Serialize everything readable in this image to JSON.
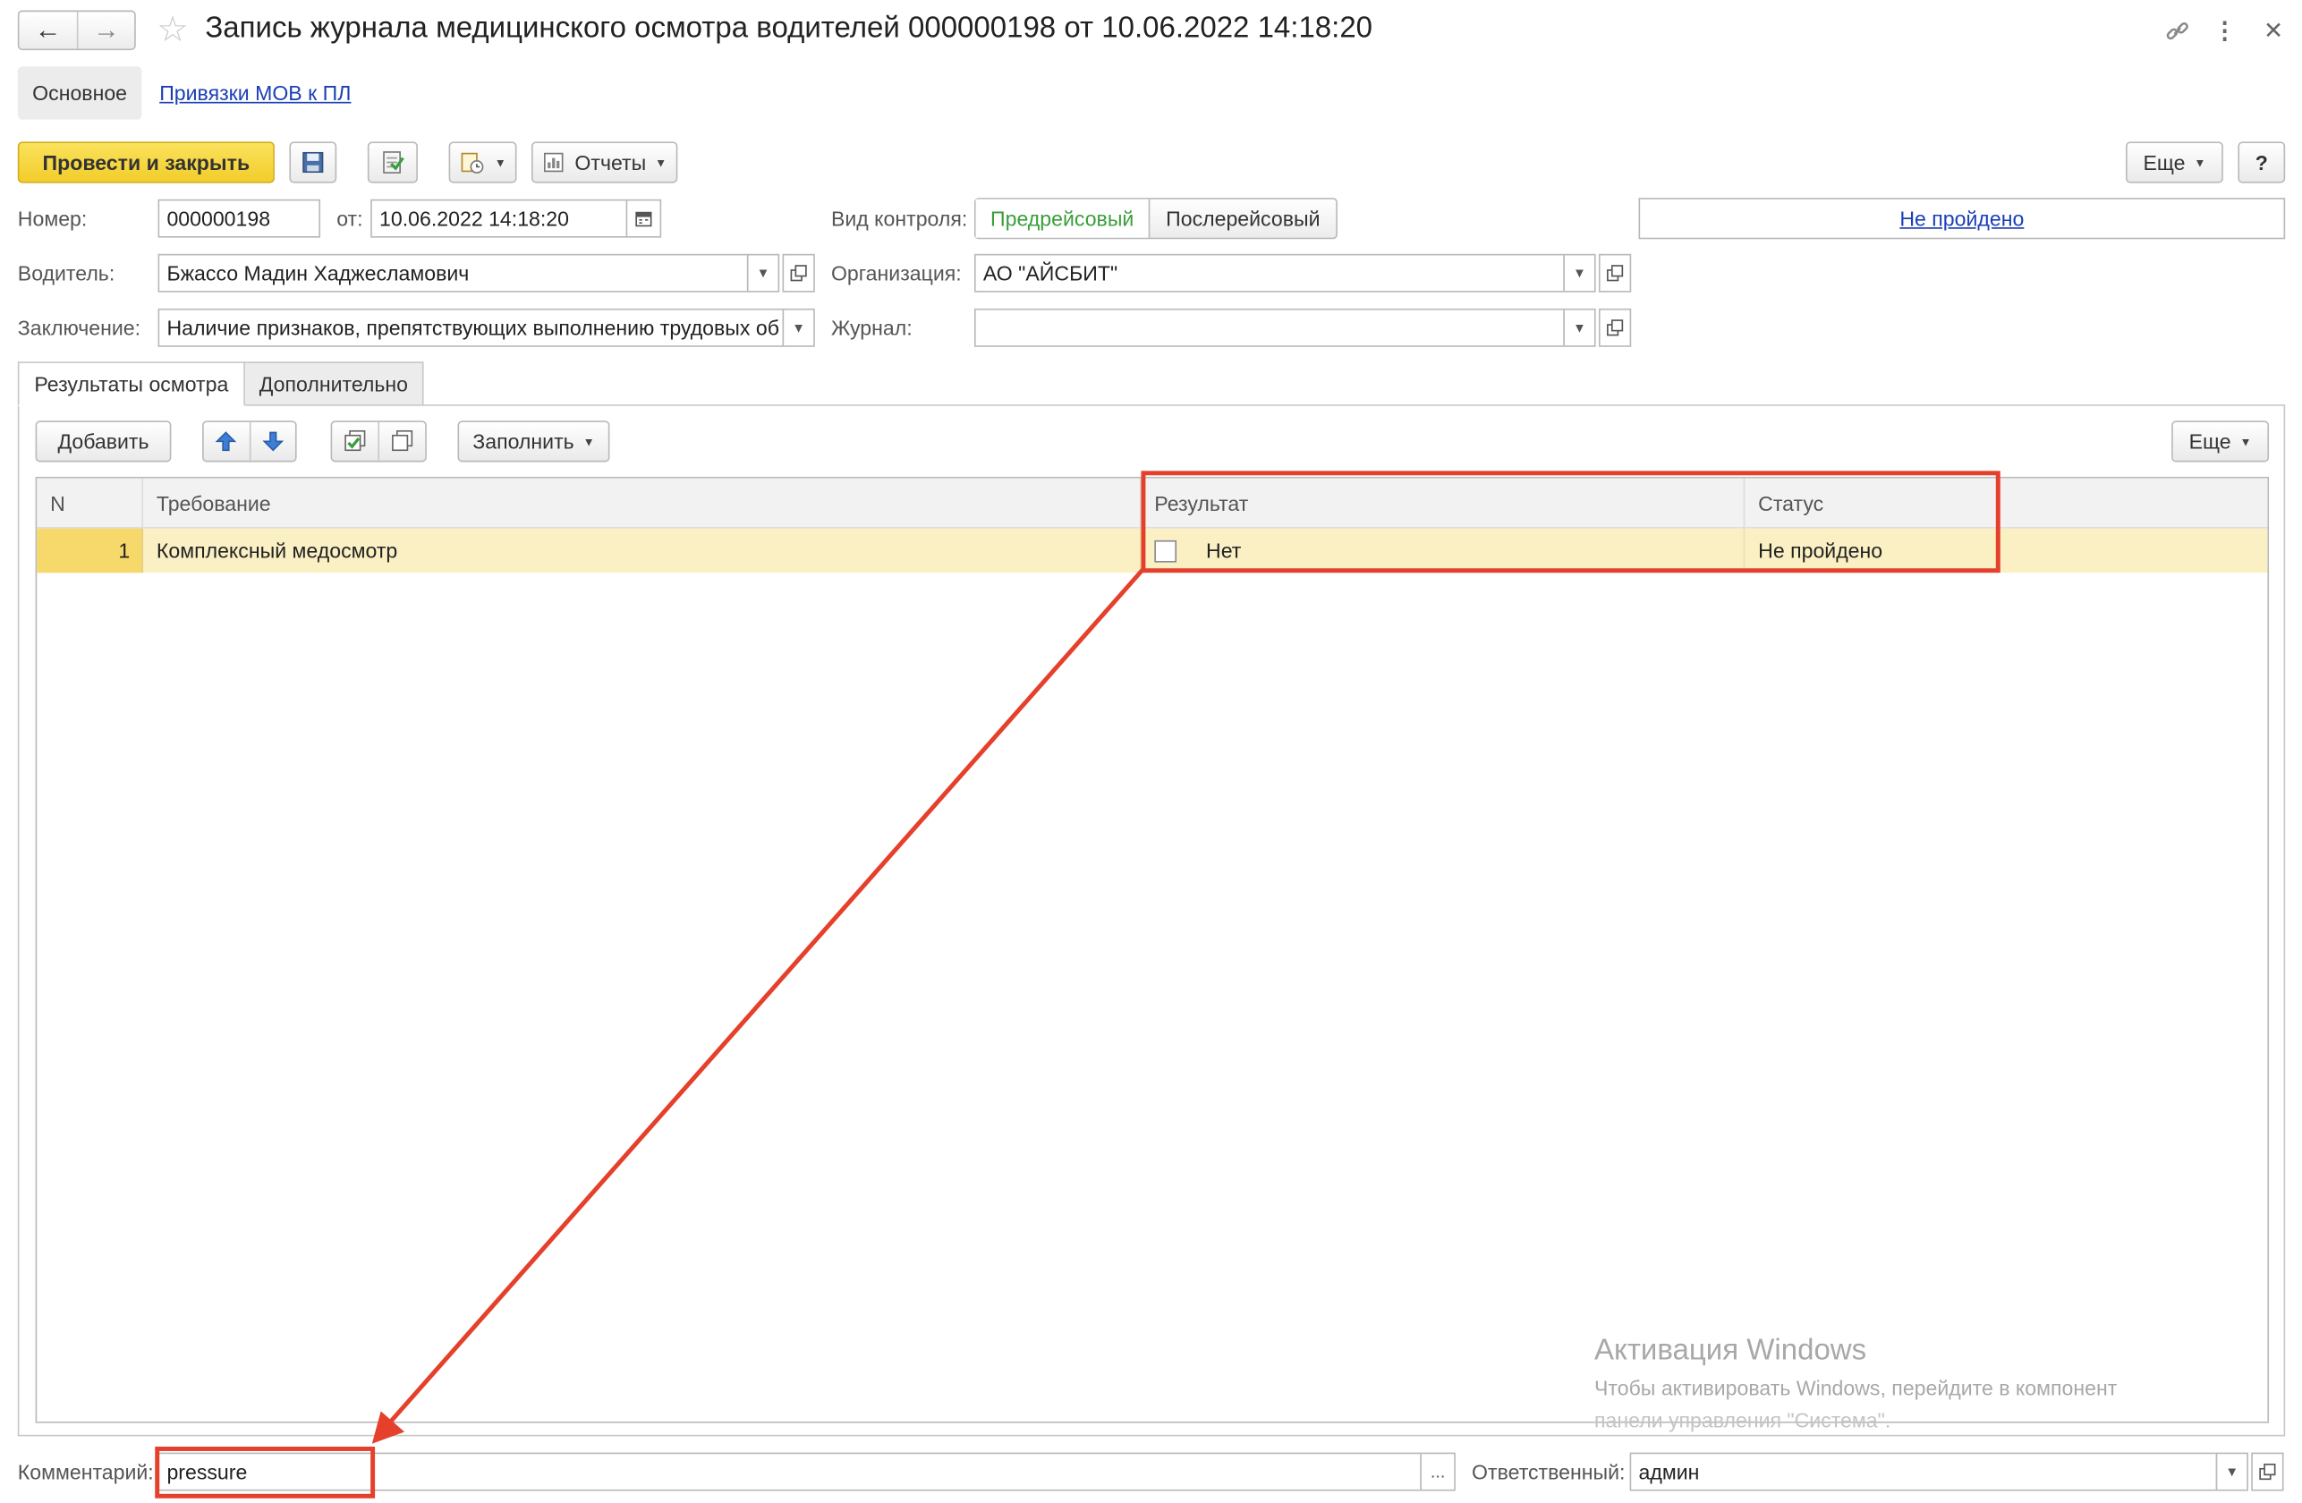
{
  "window": {
    "title": "Запись журнала медицинского осмотра водителей 000000198 от 10.06.2022 14:18:20"
  },
  "nav_tabs": [
    "Основное",
    "Привязки МОВ к ПЛ"
  ],
  "toolbar": {
    "post_close": "Провести и закрыть",
    "reports": "Отчеты",
    "more": "Еще",
    "help": "?"
  },
  "form": {
    "number_label": "Номер:",
    "number_value": "000000198",
    "date_label": "от:",
    "date_value": "10.06.2022 14:18:20",
    "control_label": "Вид контроля:",
    "control_options": [
      "Предрейсовый",
      "Послерейсовый"
    ],
    "status_link": "Не пройдено",
    "driver_label": "Водитель:",
    "driver_value": "Бжассо Мадин Хаджесламович",
    "org_label": "Организация:",
    "org_value": "АО \"АЙСБИТ\"",
    "conclusion_label": "Заключение:",
    "conclusion_value": "Наличие признаков, препятствующих выполнению трудовых об",
    "journal_label": "Журнал:",
    "journal_value": ""
  },
  "inner_tabs": [
    "Результаты осмотра",
    "Дополнительно"
  ],
  "table_toolbar": {
    "add": "Добавить",
    "fill": "Заполнить",
    "more": "Еще"
  },
  "table": {
    "columns": [
      "N",
      "Требование",
      "Результат",
      "Статус"
    ],
    "rows": [
      {
        "n": "1",
        "requirement": "Комплексный медосмотр",
        "result_checked": false,
        "result_text": "Нет",
        "status": "Не пройдено"
      }
    ]
  },
  "footer": {
    "comment_label": "Комментарий:",
    "comment_value": "pressure",
    "comment_select": "...",
    "responsible_label": "Ответственный:",
    "responsible_value": "админ"
  },
  "watermark": {
    "title": "Активация Windows",
    "line1": "Чтобы активировать Windows, перейдите в компонент",
    "line2": "панели управления \"Система\"."
  },
  "colors": {
    "accent_yellow": "#f7d73e",
    "selected_row": "#fbf0c4",
    "link_blue": "#1a3fb5",
    "active_green": "#3a9e3a",
    "annotation_red": "#e5402b"
  }
}
